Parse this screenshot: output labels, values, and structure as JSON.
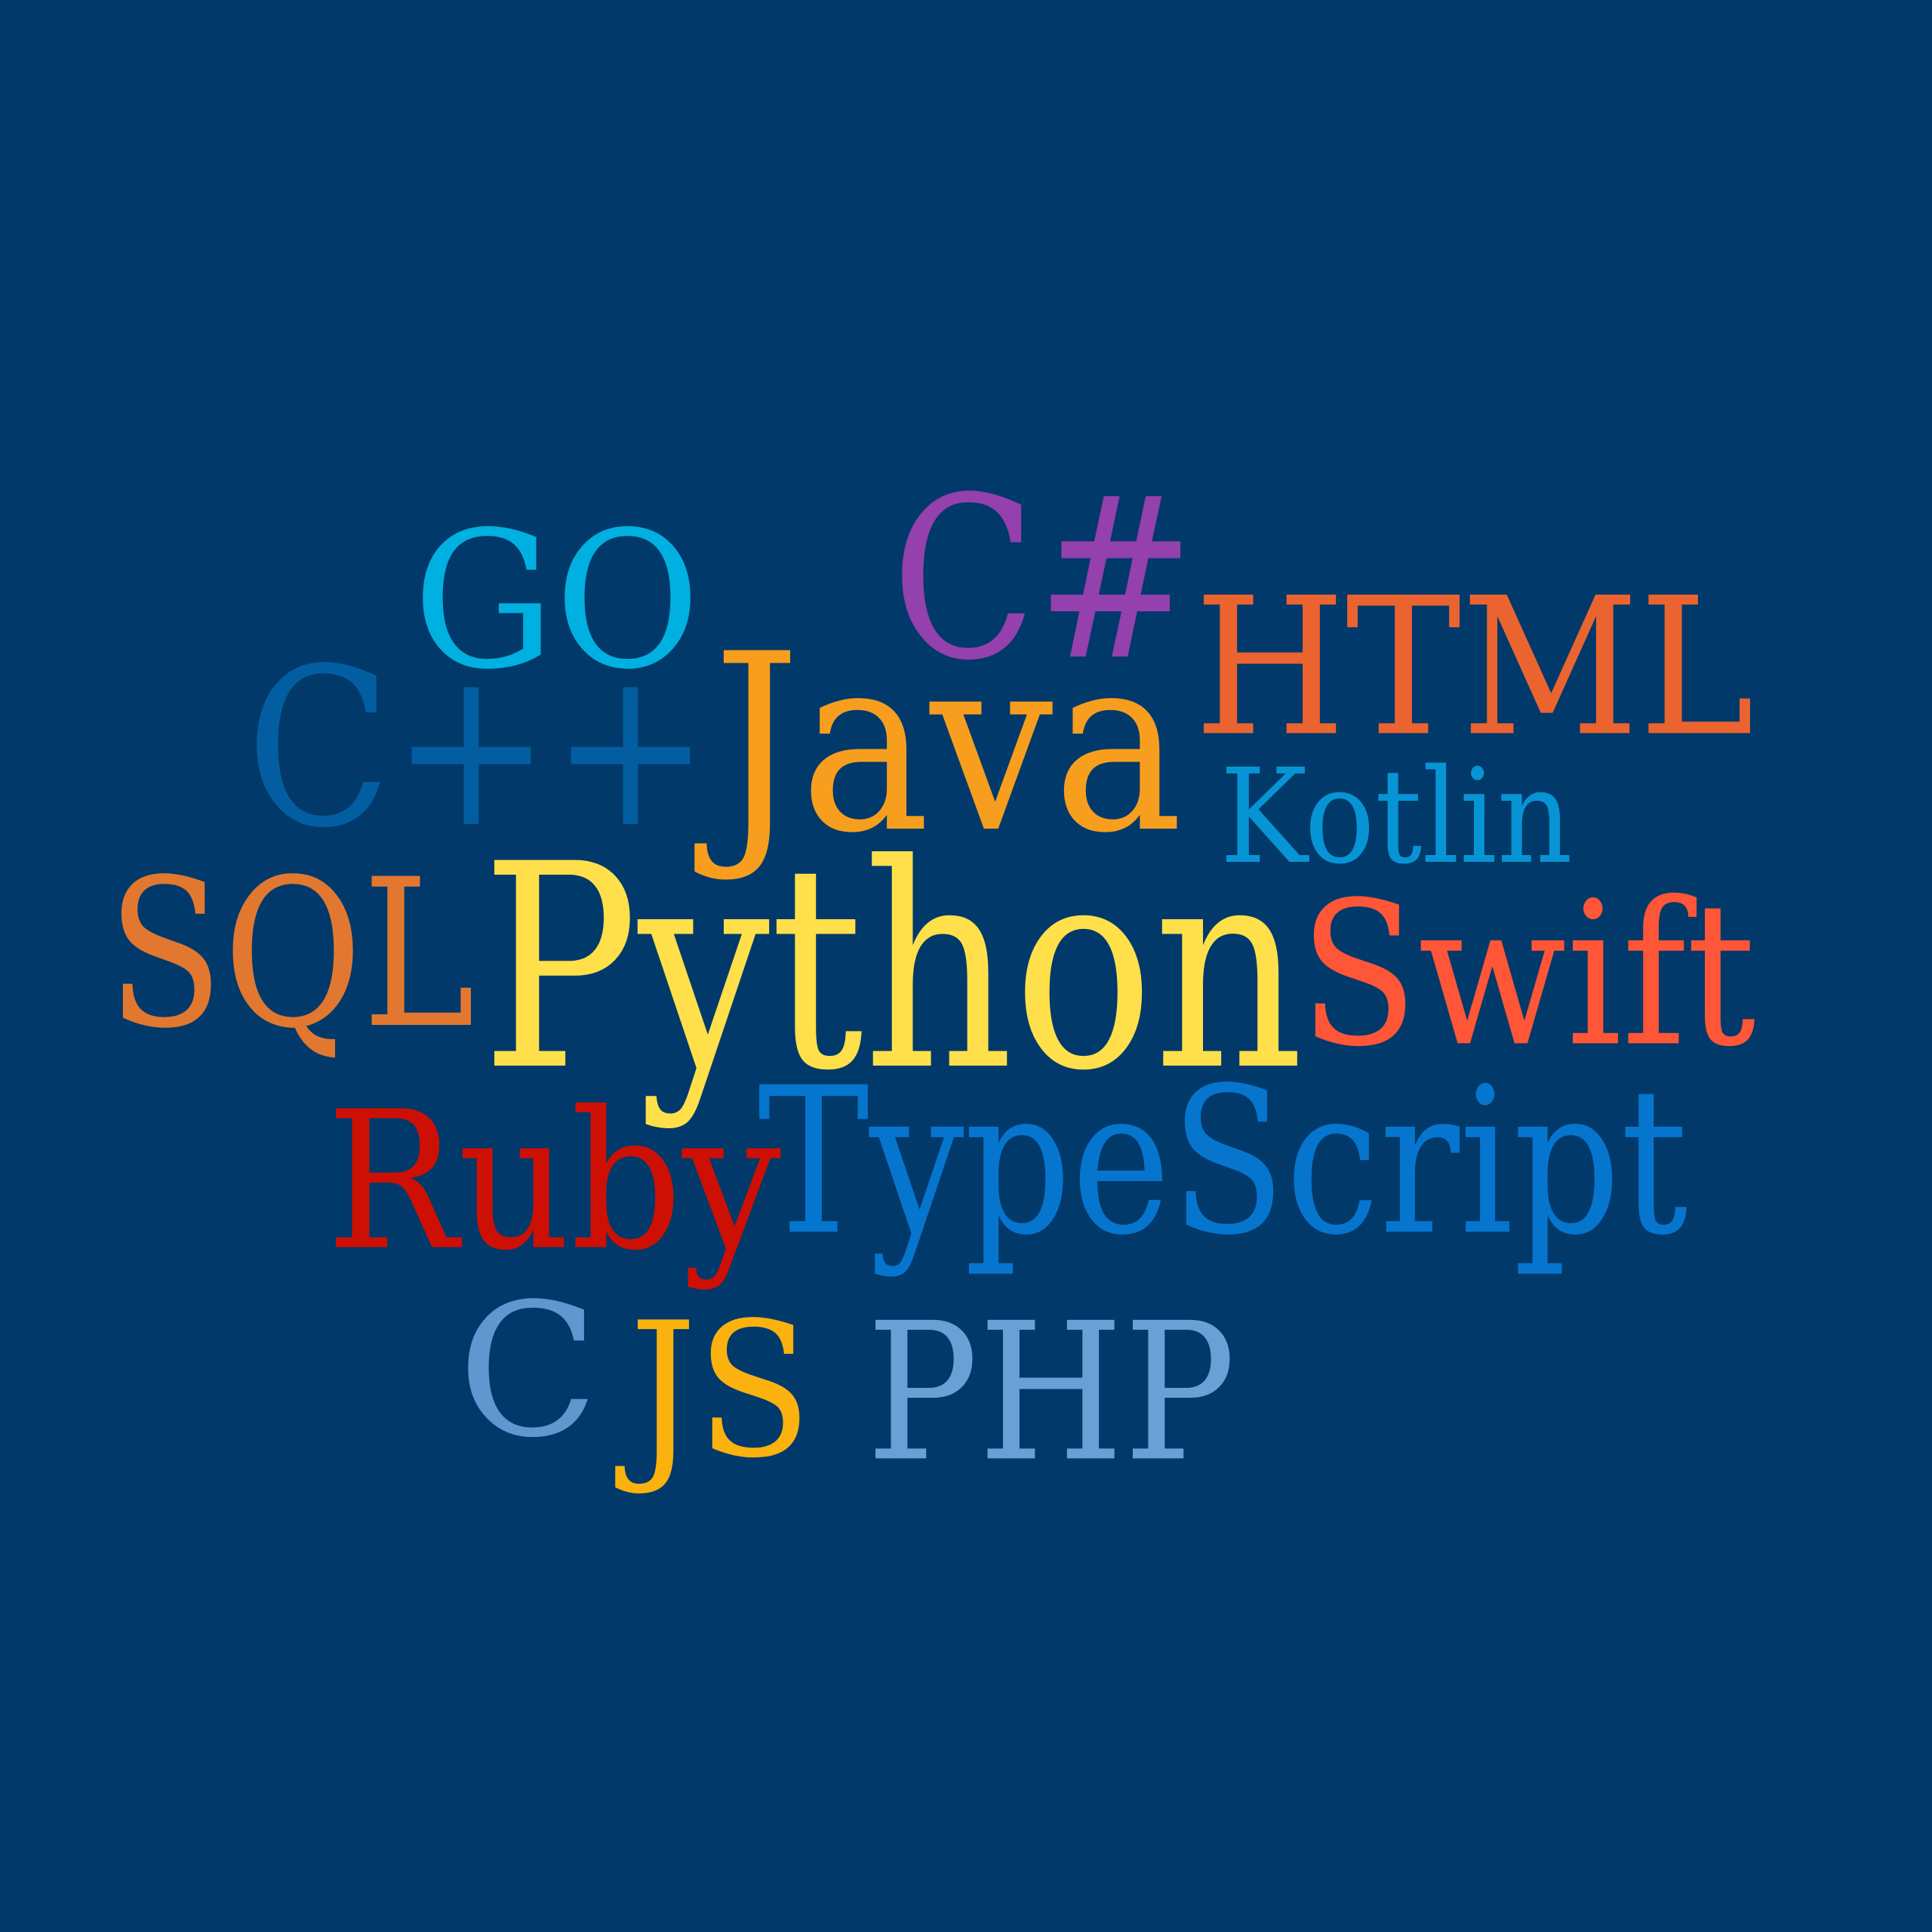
{
  "background": "#01396a",
  "words": [
    {
      "id": "go",
      "text": "GO",
      "color": "#00b0e0"
    },
    {
      "id": "csharp",
      "text": "C#",
      "color": "#9440ad"
    },
    {
      "id": "html",
      "text": "HTML",
      "color": "#eb6430"
    },
    {
      "id": "cpp",
      "text": "C++",
      "color": "#025ea0"
    },
    {
      "id": "java",
      "text": "Java",
      "color": "#f79e1e"
    },
    {
      "id": "kotlin",
      "text": "Kotlin",
      "color": "#0794d4"
    },
    {
      "id": "sql",
      "text": "SQL",
      "color": "#e27830"
    },
    {
      "id": "python",
      "text": "Python",
      "color": "#ffe04a"
    },
    {
      "id": "swift",
      "text": "Swift",
      "color": "#fe5637"
    },
    {
      "id": "ruby",
      "text": "Ruby",
      "color": "#cd1003"
    },
    {
      "id": "typescript",
      "text": "TypeScript",
      "color": "#0675ce"
    },
    {
      "id": "c",
      "text": "C",
      "color": "#5f97cf"
    },
    {
      "id": "js",
      "text": "JS",
      "color": "#fbb20e"
    },
    {
      "id": "php",
      "text": "PHP",
      "color": "#6aa0d6"
    }
  ]
}
